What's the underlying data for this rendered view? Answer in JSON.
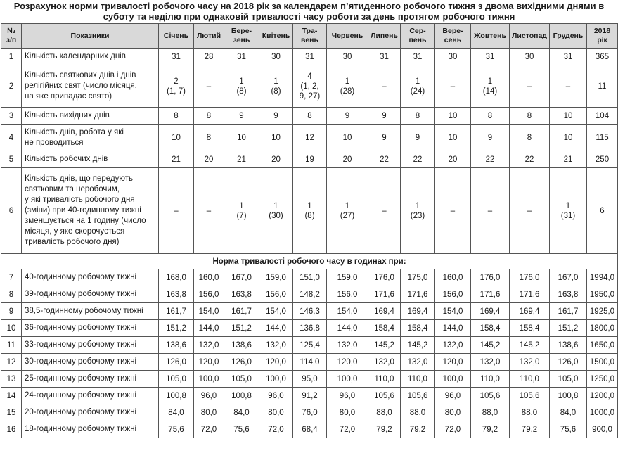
{
  "title": "Розрахунок норми тривалості робочого часу на 2018 рік за календарем п’ятиденного робочого тижня з двома вихідними днями в суботу та неділю при однаковій тривалості часу роботи за день протягом робочого тижня",
  "columns": {
    "num": "№\nз/п",
    "indicator": "Показники",
    "jan": "Січень",
    "feb": "Лютий",
    "mar": "Бере-\nзень",
    "apr": "Квітень",
    "may": "Тра-\nвень",
    "jun": "Червень",
    "jul": "Липень",
    "aug": "Сер-\nпень",
    "sep": "Вере-\nсень",
    "oct": "Жовтень",
    "nov": "Листопад",
    "dec": "Грудень",
    "year": "2018\nрік"
  },
  "rows_top": [
    {
      "num": "1",
      "name": "Кількість календарних днів",
      "v": [
        "31",
        "28",
        "31",
        "30",
        "31",
        "30",
        "31",
        "31",
        "30",
        "31",
        "30",
        "31",
        "365"
      ]
    },
    {
      "num": "2",
      "name": "Кількість святкових днів і днів\nрелігійних свят (число місяця,\nна яке припадає свято)",
      "v": [
        "2\n(1, 7)",
        "–",
        "1\n(8)",
        "1\n(8)",
        "4\n(1, 2,\n9, 27)",
        "1\n(28)",
        "–",
        "1\n(24)",
        "–",
        "1\n(14)",
        "–",
        "–",
        "11"
      ]
    },
    {
      "num": "3",
      "name": "Кількість вихідних днів",
      "v": [
        "8",
        "8",
        "9",
        "9",
        "8",
        "9",
        "9",
        "8",
        "10",
        "8",
        "8",
        "10",
        "104"
      ]
    },
    {
      "num": "4",
      "name": "Кількість днів, робота у які\nне проводиться",
      "v": [
        "10",
        "8",
        "10",
        "10",
        "12",
        "10",
        "9",
        "9",
        "10",
        "9",
        "8",
        "10",
        "115"
      ]
    },
    {
      "num": "5",
      "name": "Кількість робочих днів",
      "v": [
        "21",
        "20",
        "21",
        "20",
        "19",
        "20",
        "22",
        "22",
        "20",
        "22",
        "22",
        "21",
        "250"
      ]
    },
    {
      "num": "6",
      "name": "Кількість днів, що передують\nсвятковим та неробочим,\nу які тривалість робочого дня\n(зміни) при 40-годинному тижні\nзменшується на 1 годину (число\nмісяця, у яке скорочується\nтривалість робочого дня)",
      "v": [
        "–",
        "–",
        "1\n(7)",
        "1\n(30)",
        "1\n(8)",
        "1\n(27)",
        "–",
        "1\n(23)",
        "–",
        "–",
        "–",
        "1\n(31)",
        "6"
      ]
    }
  ],
  "section_label": "Норма тривалості робочого часу в годинах при:",
  "rows_hours": [
    {
      "num": "7",
      "name": "40-годинному робочому тижні",
      "v": [
        "168,0",
        "160,0",
        "167,0",
        "159,0",
        "151,0",
        "159,0",
        "176,0",
        "175,0",
        "160,0",
        "176,0",
        "176,0",
        "167,0",
        "1994,0"
      ]
    },
    {
      "num": "8",
      "name": "39-годинному робочому тижні",
      "v": [
        "163,8",
        "156,0",
        "163,8",
        "156,0",
        "148,2",
        "156,0",
        "171,6",
        "171,6",
        "156,0",
        "171,6",
        "171,6",
        "163,8",
        "1950,0"
      ]
    },
    {
      "num": "9",
      "name": "38,5-годинному робочому тижні",
      "v": [
        "161,7",
        "154,0",
        "161,7",
        "154,0",
        "146,3",
        "154,0",
        "169,4",
        "169,4",
        "154,0",
        "169,4",
        "169,4",
        "161,7",
        "1925,0"
      ]
    },
    {
      "num": "10",
      "name": "36-годинному робочому тижні",
      "v": [
        "151,2",
        "144,0",
        "151,2",
        "144,0",
        "136,8",
        "144,0",
        "158,4",
        "158,4",
        "144,0",
        "158,4",
        "158,4",
        "151,2",
        "1800,0"
      ]
    },
    {
      "num": "11",
      "name": "33-годинному робочому тижні",
      "v": [
        "138,6",
        "132,0",
        "138,6",
        "132,0",
        "125,4",
        "132,0",
        "145,2",
        "145,2",
        "132,0",
        "145,2",
        "145,2",
        "138,6",
        "1650,0"
      ]
    },
    {
      "num": "12",
      "name": "30-годинному робочому тижні",
      "v": [
        "126,0",
        "120,0",
        "126,0",
        "120,0",
        "114,0",
        "120,0",
        "132,0",
        "132,0",
        "120,0",
        "132,0",
        "132,0",
        "126,0",
        "1500,0"
      ]
    },
    {
      "num": "13",
      "name": "25-годинному робочому тижні",
      "v": [
        "105,0",
        "100,0",
        "105,0",
        "100,0",
        "95,0",
        "100,0",
        "110,0",
        "110,0",
        "100,0",
        "110,0",
        "110,0",
        "105,0",
        "1250,0"
      ]
    },
    {
      "num": "14",
      "name": "24-годинному робочому тижні",
      "v": [
        "100,8",
        "96,0",
        "100,8",
        "96,0",
        "91,2",
        "96,0",
        "105,6",
        "105,6",
        "96,0",
        "105,6",
        "105,6",
        "100,8",
        "1200,0"
      ]
    },
    {
      "num": "15",
      "name": "20-годинному робочому тижні",
      "v": [
        "84,0",
        "80,0",
        "84,0",
        "80,0",
        "76,0",
        "80,0",
        "88,0",
        "88,0",
        "80,0",
        "88,0",
        "88,0",
        "84,0",
        "1000,0"
      ]
    },
    {
      "num": "16",
      "name": "18-годинному робочому тижні",
      "v": [
        "75,6",
        "72,0",
        "75,6",
        "72,0",
        "68,4",
        "72,0",
        "79,2",
        "79,2",
        "72,0",
        "79,2",
        "79,2",
        "75,6",
        "900,0"
      ]
    }
  ]
}
